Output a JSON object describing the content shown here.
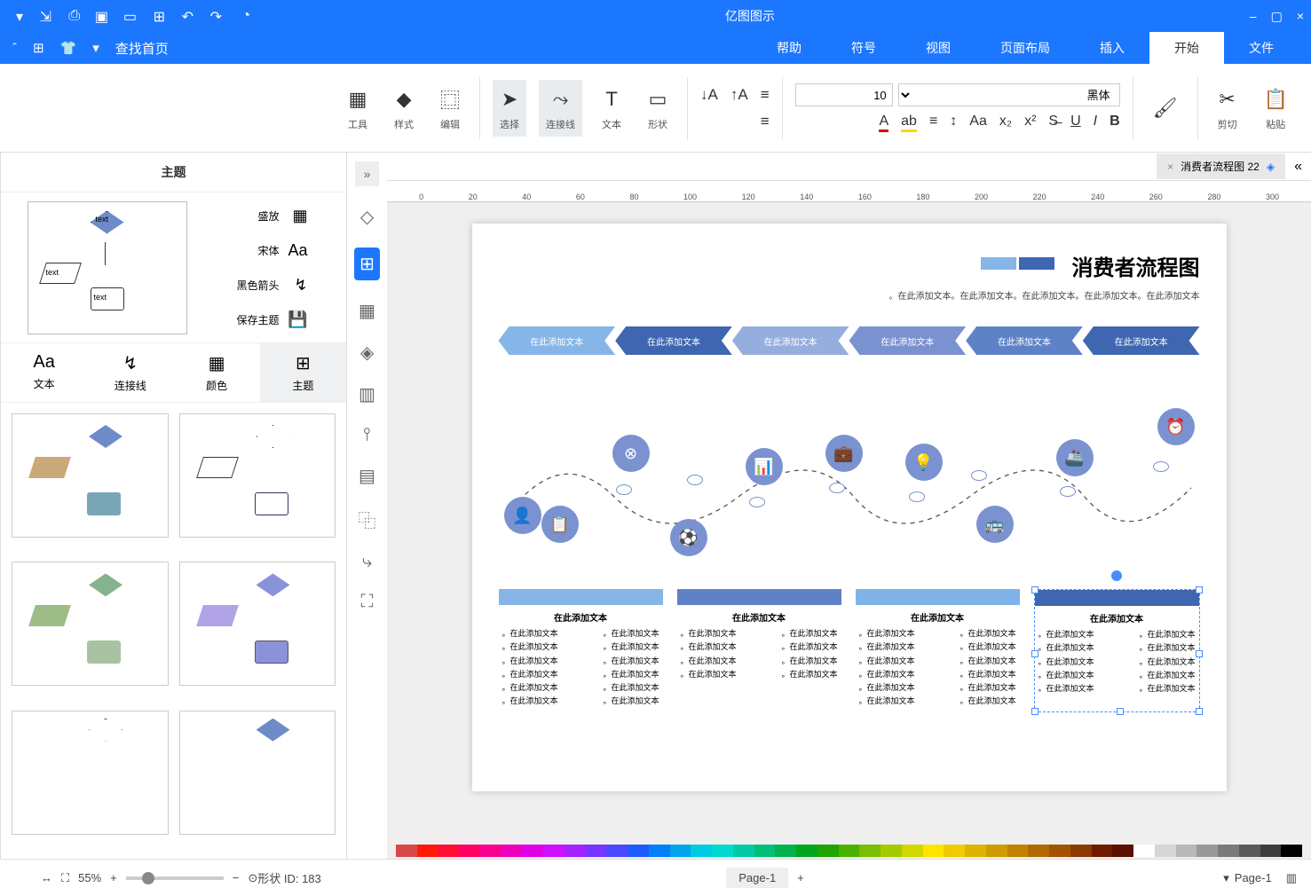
{
  "app_title": "亿图图示",
  "window": {
    "minimize": "–",
    "maximize": "▢",
    "close": "×"
  },
  "qat_icons": [
    "logo",
    "redo",
    "undo",
    "new",
    "open",
    "save",
    "print",
    "export",
    "more"
  ],
  "menutabs": [
    "文件",
    "开始",
    "插入",
    "页面布局",
    "视图",
    "符号",
    "帮助"
  ],
  "active_tab": "开始",
  "right_menu": {
    "search": "查找首页",
    "dropdown": "▾"
  },
  "ribbon": {
    "paste": "粘贴",
    "copy": "剪切",
    "select": "选择",
    "connector": "连接线",
    "text_tool": "文本",
    "shape": "形状",
    "font_family": "黑体",
    "font_size": "10",
    "edit": "编辑",
    "style": "样式",
    "tools": "工具"
  },
  "doc_tab": {
    "name": "消费者流程图 22",
    "close": "×"
  },
  "ruler_marks": [
    "0",
    "20",
    "40",
    "60",
    "80",
    "100",
    "120",
    "140",
    "160",
    "180",
    "200",
    "220",
    "240",
    "260",
    "280",
    "300"
  ],
  "panel": {
    "header": "主题",
    "effects": "盛放",
    "font": "宋体",
    "line": "黑色箭头",
    "save": "保存主题",
    "tabs": [
      "主题",
      "颜色",
      "连接线",
      "文本"
    ]
  },
  "page": {
    "title": "消费者流程图",
    "subtitle": "在此添加文本。在此添加文本。在此添加文本。在此添加文本。在此添加文本。",
    "arrows": [
      "在此添加文本",
      "在此添加文本",
      "在此添加文本",
      "在此添加文本",
      "在此添加文本",
      "在此添加文本"
    ],
    "arrow_colors": [
      "#3f66b0",
      "#5f82c7",
      "#7a92d0",
      "#96aedd",
      "#96aedd",
      "#86b5e8"
    ],
    "col_head_colors": [
      "#3f66b0",
      "#7fb3e8",
      "#5f82c7",
      "#86b5e8"
    ],
    "col_title": "在此添加文本",
    "bullet": "在此添加文本。"
  },
  "status": {
    "pagesel": "Page-1",
    "pagetab": "Page-1",
    "add": "+",
    "shape_info": "形状 ID: 183",
    "zoom": "55%"
  },
  "colorbar": [
    "#000000",
    "#3d3d3d",
    "#5b5b5b",
    "#7a7a7a",
    "#999999",
    "#b8b8b8",
    "#d6d6d6",
    "#ffffff",
    "#5b0f00",
    "#701a00",
    "#8b3a00",
    "#a35200",
    "#b06a00",
    "#bf8300",
    "#cf9b00",
    "#deb400",
    "#eecc00",
    "#fde500",
    "#d0d800",
    "#a4cb00",
    "#77bf00",
    "#4bb200",
    "#1ea500",
    "#00a51e",
    "#00b24b",
    "#00bf77",
    "#00cba4",
    "#00d8d0",
    "#00cbe0",
    "#00a5ec",
    "#0080f8",
    "#1e5bff",
    "#4b48ff",
    "#7735ff",
    "#a422ff",
    "#d00fff",
    "#e000e8",
    "#ec00bb",
    "#f8008e",
    "#ff0062",
    "#ff0d35",
    "#ff1a08",
    "#d94848"
  ]
}
